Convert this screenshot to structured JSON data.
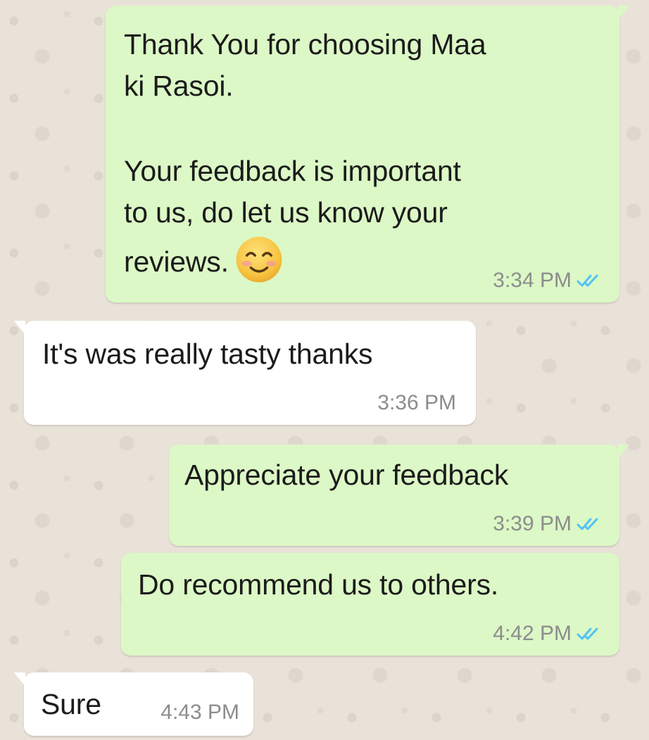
{
  "chat": {
    "messages": [
      {
        "direction": "outgoing",
        "paragraph1_line1": "Thank You for choosing Maa",
        "paragraph1_line2": "ki Rasoi.",
        "paragraph2_line1": "Your feedback is important",
        "paragraph2_line2": "to us, do let us know your",
        "paragraph2_line3": "reviews.",
        "emoji": "smiling-face-icon",
        "time": "3:34 PM",
        "status": "read"
      },
      {
        "direction": "incoming",
        "text": "It's was really tasty thanks",
        "time": "3:36 PM"
      },
      {
        "direction": "outgoing",
        "text": "Appreciate your feedback",
        "time": "3:39 PM",
        "status": "read"
      },
      {
        "direction": "outgoing",
        "text": "Do recommend us to others.",
        "time": "4:42 PM",
        "status": "read"
      },
      {
        "direction": "incoming",
        "text": "Sure",
        "time": "4:43 PM"
      }
    ]
  },
  "colors": {
    "outgoing_bubble": "#dcf8c6",
    "incoming_bubble": "#ffffff",
    "read_ticks": "#4fc3f7",
    "timestamp": "#8c8c8c",
    "wallpaper": "#e9e2d8"
  }
}
